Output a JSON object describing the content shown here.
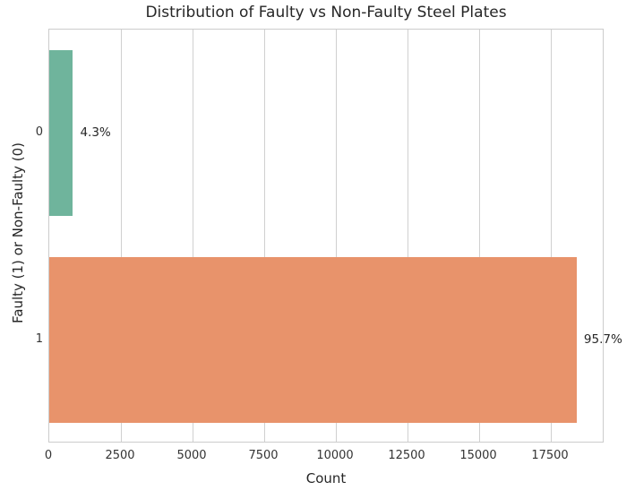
{
  "chart_data": {
    "type": "bar",
    "orientation": "horizontal",
    "title": "Distribution of Faulty vs Non-Faulty Steel Plates",
    "xlabel": "Count",
    "ylabel": "Faulty (1) or Non-Faulty (0)",
    "categories": [
      "0",
      "1"
    ],
    "values": [
      827,
      18403
    ],
    "data_labels": [
      "4.3%",
      "95.7%"
    ],
    "percentages": [
      4.3,
      95.7
    ],
    "colors": [
      "#6fb49c",
      "#e8936b"
    ],
    "xlim": [
      0,
      19375
    ],
    "xticks": [
      0,
      2500,
      5000,
      7500,
      10000,
      12500,
      15000,
      17500
    ],
    "xtick_labels": [
      "0",
      "2500",
      "5000",
      "7500",
      "10000",
      "12500",
      "15000",
      "17500"
    ],
    "ytick_labels": [
      "0",
      "1"
    ],
    "grid": "x-only",
    "grid_color": "#d0d0d0",
    "legend": "none",
    "background": "#ffffff",
    "style": "whitegrid"
  }
}
